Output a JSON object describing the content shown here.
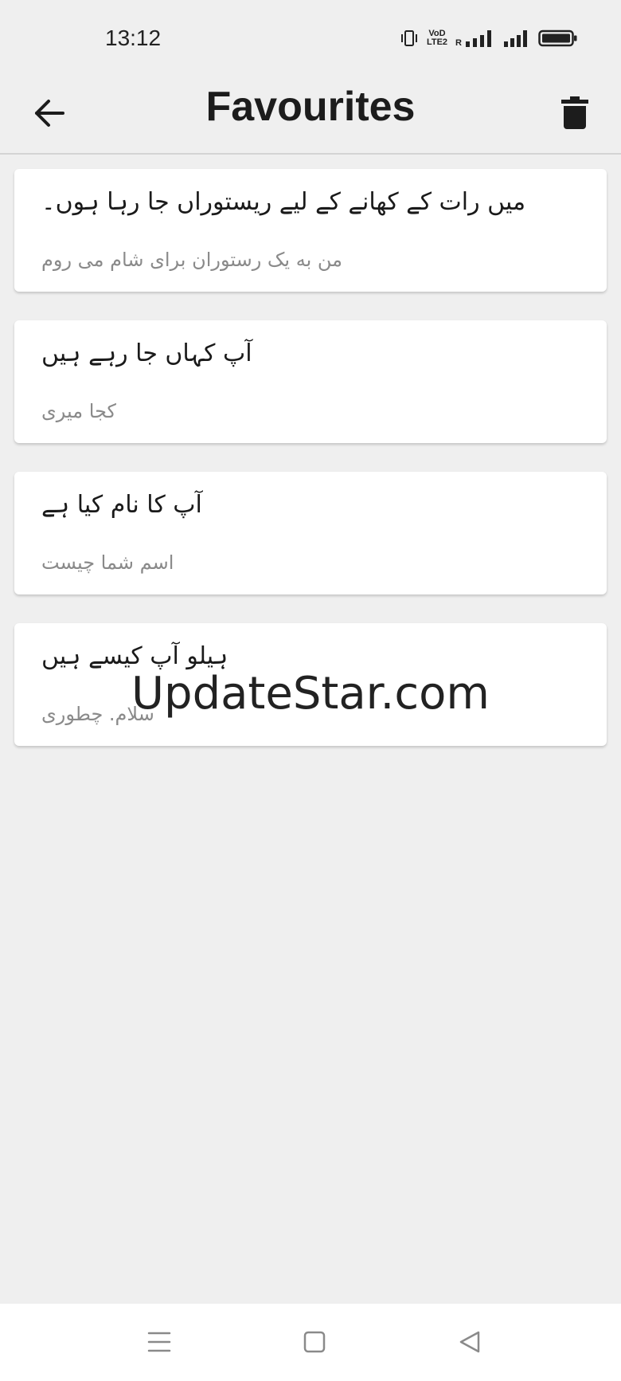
{
  "status_bar": {
    "time": "13:12",
    "volte_line1": "VoD",
    "volte_line2": "LTE2",
    "roaming": "R"
  },
  "app_bar": {
    "title": "Favourites"
  },
  "favourites": [
    {
      "primary": "میں رات کے کھانے کے لیے ریستوراں جا رہا ہوں۔",
      "secondary": "من به یک رستوران برای شام می روم"
    },
    {
      "primary": "آپ کہاں جا رہے ہیں",
      "secondary": "کجا میری"
    },
    {
      "primary": "آپ کا نام کیا ہے",
      "secondary": "اسم شما چیست"
    },
    {
      "primary": "ہیلو آپ کیسے ہیں",
      "secondary": "سلام. چطوری"
    }
  ],
  "watermark": "UpdateStar.com",
  "colors": {
    "background": "#efefef",
    "card": "#ffffff",
    "primary_text": "#1a1a1a",
    "secondary_text": "#8a8a8a",
    "icon": "#1c1c1c"
  }
}
